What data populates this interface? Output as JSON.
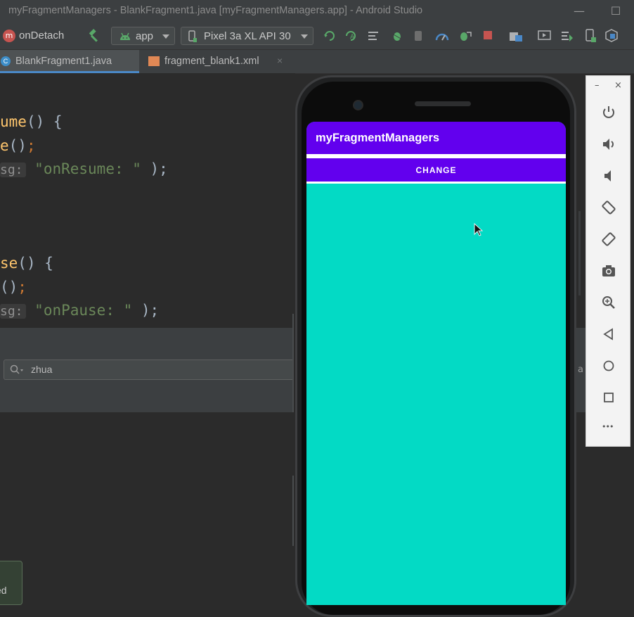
{
  "window": {
    "title": "myFragmentManagers - BlankFragment1.java [myFragmentManagers.app] - Android Studio",
    "minimize_glyph": "—",
    "maximize_glyph": "☐"
  },
  "toolbar": {
    "method_label": "onDetach",
    "method_badge": "m",
    "run_config": "app",
    "device": "Pixel 3a XL API 30"
  },
  "tabs": [
    {
      "label": "BlankFragment1.java",
      "icon": "class-c-icon",
      "active": true
    },
    {
      "label": "fragment_blank1.xml",
      "icon": "layout-xml-icon",
      "active": false
    }
  ],
  "tab_close_glyph": "×",
  "code": {
    "l1_name": "ume",
    "l1_rest": "() {",
    "l2_name": "e",
    "l2_rest": "()",
    "l2_semi": ";",
    "l3_hint": "sg:",
    "l3_str": "\"onResume: \"",
    "l3_rest": " );",
    "l4_name": "se",
    "l4_rest": "() {",
    "l5_rest": "()",
    "l5_semi": ";",
    "l6_hint": "sg:",
    "l6_str": "\"onPause: \"",
    "l6_rest": " );"
  },
  "logcat": {
    "search_value": "zhua",
    "edge_char": "a"
  },
  "notification": {
    "label": "ed"
  },
  "app": {
    "title": "myFragmentManagers",
    "button_label": "CHANGE",
    "background_color": "#03dac5",
    "primary_color": "#6200ee"
  },
  "emulator": {
    "minimize_glyph": "–",
    "close_glyph": "×",
    "more_glyph": "•••"
  }
}
